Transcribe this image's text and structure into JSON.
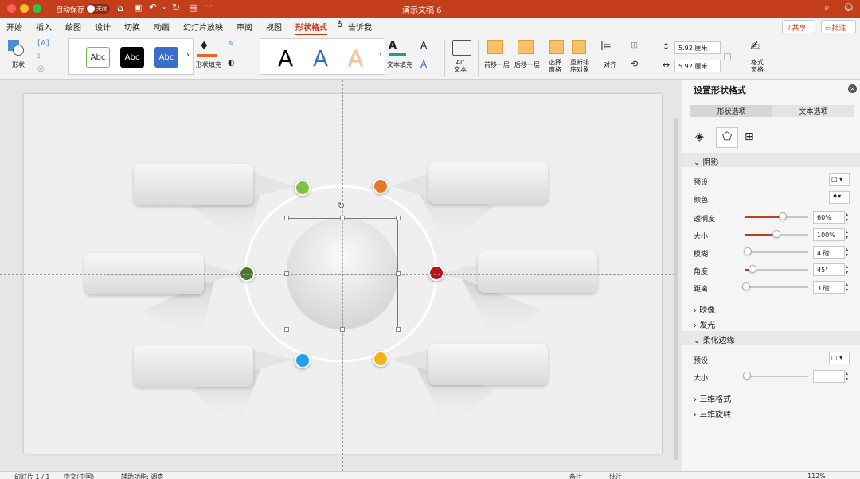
{
  "titlebar": {
    "autosave_label": "自动保存",
    "autosave_state": "关闭",
    "doc_title": "演示文稿 6"
  },
  "tabs": [
    "开始",
    "插入",
    "绘图",
    "设计",
    "切换",
    "动画",
    "幻灯片放映",
    "审阅",
    "视图",
    "形状格式",
    "告诉我"
  ],
  "actions": {
    "share": "共享",
    "comments": "批注"
  },
  "ribbon": {
    "shape_label": "形状",
    "styles": [
      "Abc",
      "Abc",
      "Abc"
    ],
    "fill_label": "形状填充",
    "wordart": [
      "A",
      "A",
      "A"
    ],
    "text_fill_label": "文本填充",
    "alt_text": "Alt\n文本",
    "bring_forward": "前移一层",
    "send_backward": "后移一层",
    "selection_pane": "选择\n窗格",
    "reorder": "重新排\n序对象",
    "align": "对齐",
    "height": "5.92 厘米",
    "width": "5.92 厘米",
    "format_pane": "格式\n窗格"
  },
  "panel": {
    "title": "设置形状格式",
    "tab_shape": "形状选项",
    "tab_text": "文本选项",
    "shadow_title": "阴影",
    "preset_label": "预设",
    "color_label": "颜色",
    "rows": [
      {
        "label": "透明度",
        "value": "60%",
        "level": 0.6
      },
      {
        "label": "大小",
        "value": "100%",
        "level": 0.5
      },
      {
        "label": "模糊",
        "value": "4 磅",
        "level": 0.05
      },
      {
        "label": "角度",
        "value": "45°",
        "level": 0.125
      },
      {
        "label": "距离",
        "value": "3 磅",
        "level": 0.03
      }
    ],
    "reflection": "映像",
    "glow": "发光",
    "soft_edges": "柔化边缘",
    "soft_preset": "预设",
    "soft_size": "大小",
    "format_3d": "三维格式",
    "rotation_3d": "三维旋转"
  },
  "dots": {
    "lime": "#7dc242",
    "orange": "#e8762c",
    "green": "#4a7a2a",
    "red": "#c0101a",
    "blue": "#1fa3e6",
    "yellow": "#f6b21a"
  },
  "status": {
    "slide": "幻灯片 1 / 1",
    "lang": "中文(中国)",
    "accessibility": "辅助功能: 调查",
    "notes": "备注",
    "comments": "批注",
    "zoom": "112%"
  }
}
